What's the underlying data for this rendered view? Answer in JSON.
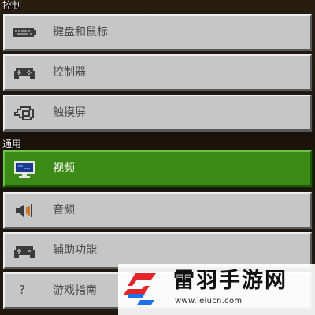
{
  "sections": {
    "control": {
      "label": "控制"
    },
    "general": {
      "label": "通用"
    }
  },
  "items": [
    {
      "label": "键盘和鼠标",
      "icon": "keyboard-icon",
      "active": false
    },
    {
      "label": "控制器",
      "icon": "gamepad-icon",
      "active": false
    },
    {
      "label": "触摸屏",
      "icon": "touch-hand-icon",
      "active": false
    },
    {
      "label": "视频",
      "icon": "monitor-icon",
      "active": true
    },
    {
      "label": "音频",
      "icon": "speaker-icon",
      "active": false
    },
    {
      "label": "辅助功能",
      "icon": "accessibility-controller-icon",
      "active": false
    },
    {
      "label": "游戏指南",
      "icon": "question-mark-icon",
      "glyph": "?",
      "active": false
    }
  ],
  "colors": {
    "active_bg": "#3c8a16",
    "item_bg": "#c6c6c6",
    "label_text": "#4a4a4a",
    "active_text": "#ffffff"
  },
  "watermark": {
    "title": "雷羽手游网",
    "url": "www.leiucn.com",
    "logo": "leiyu-logo"
  }
}
